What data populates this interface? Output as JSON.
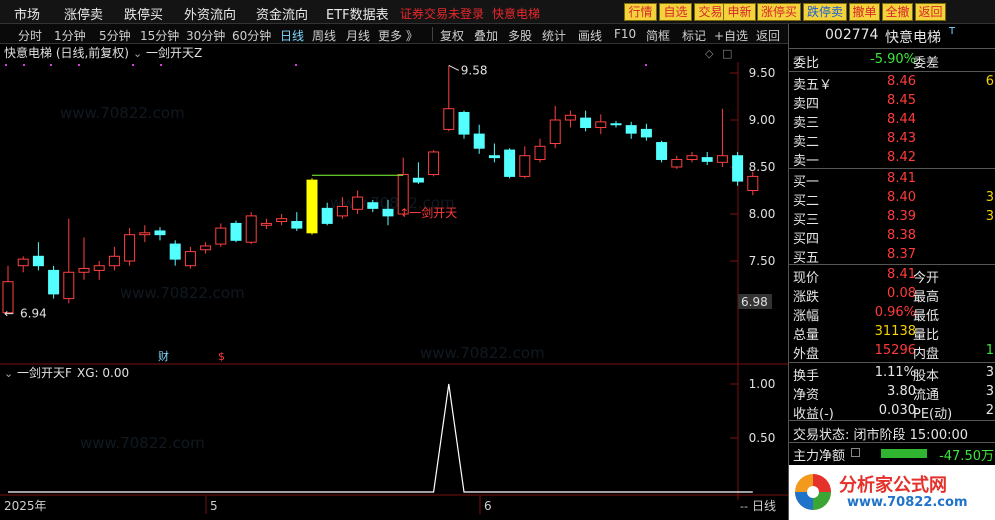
{
  "topbar": {
    "menu": [
      "市场",
      "涨停卖",
      "跌停买",
      "外资流向",
      "资金流向",
      "ETF数据表"
    ],
    "warning": "证券交易未登录",
    "stock_name_red": "快意电梯",
    "quick_buttons": [
      "行情",
      "自选",
      "交易",
      "申新",
      "涨停买",
      "跌停卖",
      "撤单",
      "全撤",
      "返回"
    ]
  },
  "toolbar": {
    "periods": [
      "分时",
      "1分钟",
      "5分钟",
      "15分钟",
      "30分钟",
      "60分钟",
      "日线",
      "周线",
      "月线",
      "更多 》"
    ],
    "active_period": "日线",
    "actions": [
      "复权",
      "叠加",
      "多股",
      "统计",
      "画线",
      "F10",
      "简框",
      "标记",
      "+自选",
      "返回"
    ]
  },
  "chart": {
    "title": "快意电梯 (日线,前复权)",
    "indicator_main": "一剑开天Z",
    "indicator_sub": "一剑开天F",
    "sub_value_label": "XG: 0.00",
    "price_axis": [
      "9.50",
      "9.00",
      "8.50",
      "8.00",
      "7.50"
    ],
    "current_price_tag": "6.98",
    "sub_axis": [
      "1.00",
      "0.50"
    ],
    "annotation_high": "9.58",
    "annotation_low": "6.94",
    "signal_label": "↑一剑开天",
    "marker_fin": "财",
    "marker_s": "$",
    "date_labels": [
      "2025年",
      "5",
      "6"
    ],
    "period_footer": "日线",
    "watermark": "www.70822.com",
    "colors": {
      "up": "#ff4040",
      "down": "#54ffff",
      "signal": "#ffff00",
      "bg": "#000000"
    }
  },
  "chart_data": {
    "type": "candlestick",
    "title": "快意电梯 (日线,前复权)",
    "ylim": [
      6.9,
      9.7
    ],
    "candles": [
      {
        "o": 6.95,
        "h": 7.45,
        "l": 6.94,
        "c": 7.28
      },
      {
        "o": 7.45,
        "h": 7.55,
        "l": 7.38,
        "c": 7.52
      },
      {
        "o": 7.55,
        "h": 7.7,
        "l": 7.4,
        "c": 7.45
      },
      {
        "o": 7.4,
        "h": 7.45,
        "l": 7.1,
        "c": 7.15
      },
      {
        "o": 7.1,
        "h": 7.95,
        "l": 7.05,
        "c": 7.38
      },
      {
        "o": 7.38,
        "h": 7.75,
        "l": 7.3,
        "c": 7.42
      },
      {
        "o": 7.4,
        "h": 7.5,
        "l": 7.3,
        "c": 7.45
      },
      {
        "o": 7.45,
        "h": 7.65,
        "l": 7.4,
        "c": 7.55
      },
      {
        "o": 7.5,
        "h": 7.85,
        "l": 7.45,
        "c": 7.78
      },
      {
        "o": 7.78,
        "h": 7.88,
        "l": 7.7,
        "c": 7.8
      },
      {
        "o": 7.82,
        "h": 7.86,
        "l": 7.72,
        "c": 7.78
      },
      {
        "o": 7.68,
        "h": 7.72,
        "l": 7.45,
        "c": 7.52
      },
      {
        "o": 7.45,
        "h": 7.65,
        "l": 7.42,
        "c": 7.6
      },
      {
        "o": 7.62,
        "h": 7.7,
        "l": 7.58,
        "c": 7.66
      },
      {
        "o": 7.68,
        "h": 7.9,
        "l": 7.65,
        "c": 7.85
      },
      {
        "o": 7.9,
        "h": 7.93,
        "l": 7.7,
        "c": 7.72
      },
      {
        "o": 7.7,
        "h": 8.02,
        "l": 7.68,
        "c": 7.98
      },
      {
        "o": 7.88,
        "h": 7.95,
        "l": 7.84,
        "c": 7.9
      },
      {
        "o": 7.92,
        "h": 8.0,
        "l": 7.88,
        "c": 7.95
      },
      {
        "o": 7.92,
        "h": 8.02,
        "l": 7.82,
        "c": 7.85
      },
      {
        "o": 7.8,
        "h": 8.38,
        "l": 7.78,
        "c": 8.36
      },
      {
        "o": 8.06,
        "h": 8.12,
        "l": 7.88,
        "c": 7.9
      },
      {
        "o": 7.98,
        "h": 8.18,
        "l": 7.95,
        "c": 8.08
      },
      {
        "o": 8.05,
        "h": 8.25,
        "l": 8.0,
        "c": 8.18
      },
      {
        "o": 8.12,
        "h": 8.15,
        "l": 8.02,
        "c": 8.06
      },
      {
        "o": 8.05,
        "h": 8.15,
        "l": 7.88,
        "c": 7.98
      },
      {
        "o": 8.0,
        "h": 8.6,
        "l": 7.98,
        "c": 8.42
      },
      {
        "o": 8.38,
        "h": 8.55,
        "l": 8.32,
        "c": 8.34
      },
      {
        "o": 8.42,
        "h": 8.68,
        "l": 8.4,
        "c": 8.66
      },
      {
        "o": 8.9,
        "h": 9.58,
        "l": 8.88,
        "c": 9.12
      },
      {
        "o": 9.08,
        "h": 9.1,
        "l": 8.8,
        "c": 8.85
      },
      {
        "o": 8.85,
        "h": 8.95,
        "l": 8.64,
        "c": 8.7
      },
      {
        "o": 8.62,
        "h": 8.75,
        "l": 8.55,
        "c": 8.6
      },
      {
        "o": 8.68,
        "h": 8.7,
        "l": 8.38,
        "c": 8.4
      },
      {
        "o": 8.4,
        "h": 8.72,
        "l": 8.38,
        "c": 8.62
      },
      {
        "o": 8.58,
        "h": 8.8,
        "l": 8.55,
        "c": 8.72
      },
      {
        "o": 8.75,
        "h": 9.15,
        "l": 8.7,
        "c": 9.0
      },
      {
        "o": 9.0,
        "h": 9.1,
        "l": 8.92,
        "c": 9.05
      },
      {
        "o": 9.02,
        "h": 9.1,
        "l": 8.88,
        "c": 8.92
      },
      {
        "o": 8.92,
        "h": 9.06,
        "l": 8.85,
        "c": 8.98
      },
      {
        "o": 8.96,
        "h": 8.99,
        "l": 8.92,
        "c": 8.95
      },
      {
        "o": 8.94,
        "h": 8.98,
        "l": 8.8,
        "c": 8.86
      },
      {
        "o": 8.9,
        "h": 8.96,
        "l": 8.78,
        "c": 8.82
      },
      {
        "o": 8.76,
        "h": 8.78,
        "l": 8.55,
        "c": 8.58
      },
      {
        "o": 8.5,
        "h": 8.62,
        "l": 8.48,
        "c": 8.58
      },
      {
        "o": 8.58,
        "h": 8.66,
        "l": 8.55,
        "c": 8.62
      },
      {
        "o": 8.6,
        "h": 8.66,
        "l": 8.52,
        "c": 8.56
      },
      {
        "o": 8.55,
        "h": 9.12,
        "l": 8.5,
        "c": 8.62
      },
      {
        "o": 8.62,
        "h": 8.66,
        "l": 8.3,
        "c": 8.35
      },
      {
        "o": 8.25,
        "h": 8.45,
        "l": 8.2,
        "c": 8.4
      }
    ],
    "signal_index": 20,
    "sub_series": {
      "name": "XG",
      "peak_index": 29,
      "peak_value": 1.0,
      "ylim": [
        0,
        1.0
      ]
    }
  },
  "panel": {
    "code": "002774",
    "name": "快意电梯",
    "wei_bi_label": "委比",
    "wei_bi": "-5.90%",
    "wei_cha_label": "委差",
    "asks": [
      {
        "label": "卖五￥",
        "price": "8.46",
        "vol": "6"
      },
      {
        "label": "卖四",
        "price": "8.45",
        "vol": ""
      },
      {
        "label": "卖三",
        "price": "8.44",
        "vol": ""
      },
      {
        "label": "卖二",
        "price": "8.43",
        "vol": ""
      },
      {
        "label": "卖一",
        "price": "8.42",
        "vol": ""
      }
    ],
    "bids": [
      {
        "label": "买一",
        "price": "8.41",
        "vol": ""
      },
      {
        "label": "买二",
        "price": "8.40",
        "vol": "3"
      },
      {
        "label": "买三",
        "price": "8.39",
        "vol": "3"
      },
      {
        "label": "买四",
        "price": "8.38",
        "vol": ""
      },
      {
        "label": "买五",
        "price": "8.37",
        "vol": ""
      }
    ],
    "stats": [
      {
        "l1": "现价",
        "v1": "8.41",
        "c1": "red",
        "l2": "今开",
        "v2": ""
      },
      {
        "l1": "涨跌",
        "v1": "0.08",
        "c1": "red",
        "l2": "最高",
        "v2": ""
      },
      {
        "l1": "涨幅",
        "v1": "0.96%",
        "c1": "red",
        "l2": "最低",
        "v2": ""
      },
      {
        "l1": "总量",
        "v1": "31138",
        "c1": "yellow",
        "l2": "量比",
        "v2": ""
      },
      {
        "l1": "外盘",
        "v1": "15296",
        "c1": "red",
        "l2": "内盘",
        "v2": "1"
      }
    ],
    "stats2": [
      {
        "l1": "换手",
        "v1": "1.11%",
        "l2": "股本",
        "v2": "3"
      },
      {
        "l1": "净资",
        "v1": "3.80",
        "l2": "流通",
        "v2": "3"
      },
      {
        "l1": "收益(-)",
        "v1": "0.030",
        "l2": "PE(动)",
        "v2": "2"
      }
    ],
    "trade_status": "交易状态: 闭市阶段 15:00:00",
    "main_flow_label": "主力净额",
    "main_flow": "-47.50万",
    "logo_text": "分析家公式网",
    "logo_url": "www.70822.com"
  }
}
